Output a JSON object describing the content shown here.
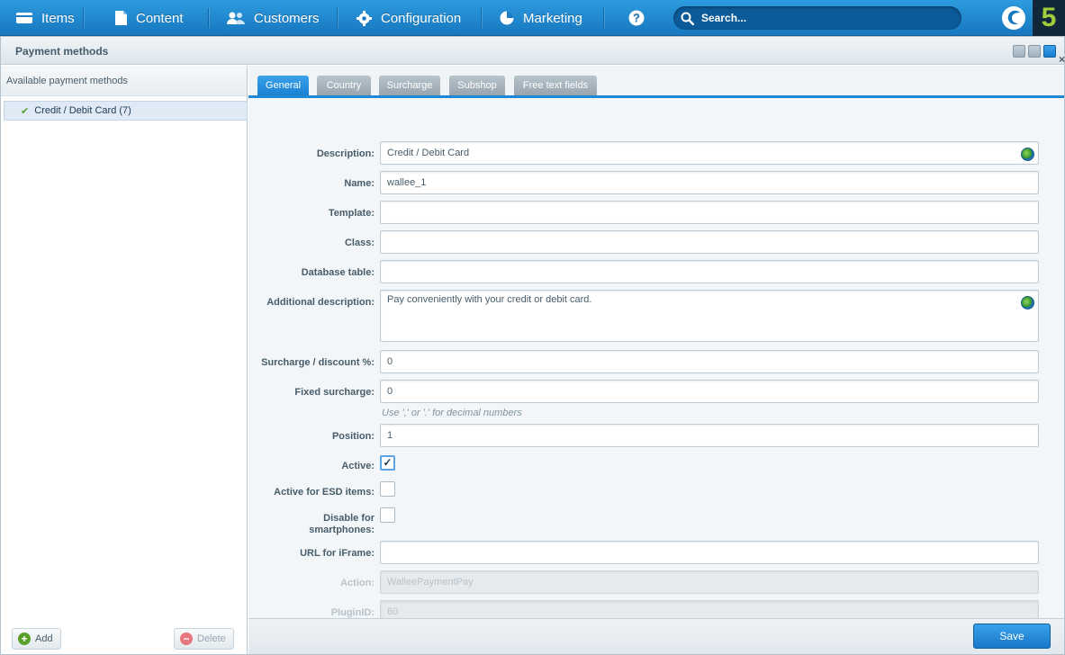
{
  "nav": {
    "items": [
      {
        "label": "Items"
      },
      {
        "label": "Content"
      },
      {
        "label": "Customers"
      },
      {
        "label": "Configuration"
      },
      {
        "label": "Marketing"
      }
    ],
    "help_icon": "question-circle-icon",
    "search_placeholder": "Search..."
  },
  "brand": {
    "logo_text": "5",
    "accent": "#a2cd3a"
  },
  "window": {
    "title": "Payment methods"
  },
  "left": {
    "header": "Available payment methods",
    "items": [
      {
        "label": "Credit / Debit Card (7)",
        "checked": true
      }
    ],
    "add_label": "Add",
    "delete_label": "Delete"
  },
  "tabs": [
    {
      "label": "General",
      "active": true
    },
    {
      "label": "Country"
    },
    {
      "label": "Surcharge"
    },
    {
      "label": "Subshop"
    },
    {
      "label": "Free text fields"
    }
  ],
  "form": {
    "description": {
      "label": "Description:",
      "value": "Credit / Debit Card"
    },
    "name": {
      "label": "Name:",
      "value": "wallee_1"
    },
    "template": {
      "label": "Template:",
      "value": ""
    },
    "class": {
      "label": "Class:",
      "value": ""
    },
    "database_table": {
      "label": "Database table:",
      "value": ""
    },
    "additional_description": {
      "label": "Additional description:",
      "value": "Pay conveniently with your credit or debit card."
    },
    "surcharge_discount": {
      "label": "Surcharge / discount %:",
      "value": "0"
    },
    "fixed_surcharge": {
      "label": "Fixed surcharge:",
      "value": "0"
    },
    "decimal_hint": "Use ',' or '.' for decimal numbers",
    "position": {
      "label": "Position:",
      "value": "1"
    },
    "active": {
      "label": "Active:",
      "checked": true
    },
    "active_esd": {
      "label": "Active for ESD items:",
      "checked": false
    },
    "disable_smartphones": {
      "label_line1": "Disable for",
      "label_line2": "smartphones:",
      "checked": false
    },
    "url_iframe": {
      "label": "URL for iFrame:",
      "value": ""
    },
    "action": {
      "label": "Action:",
      "value": "WalleePaymentPay"
    },
    "plugin_id": {
      "label": "PluginID:",
      "value": "60"
    }
  },
  "save_label": "Save",
  "colors": {
    "primary": "#1e87d6",
    "topbar": "#1777bf"
  }
}
